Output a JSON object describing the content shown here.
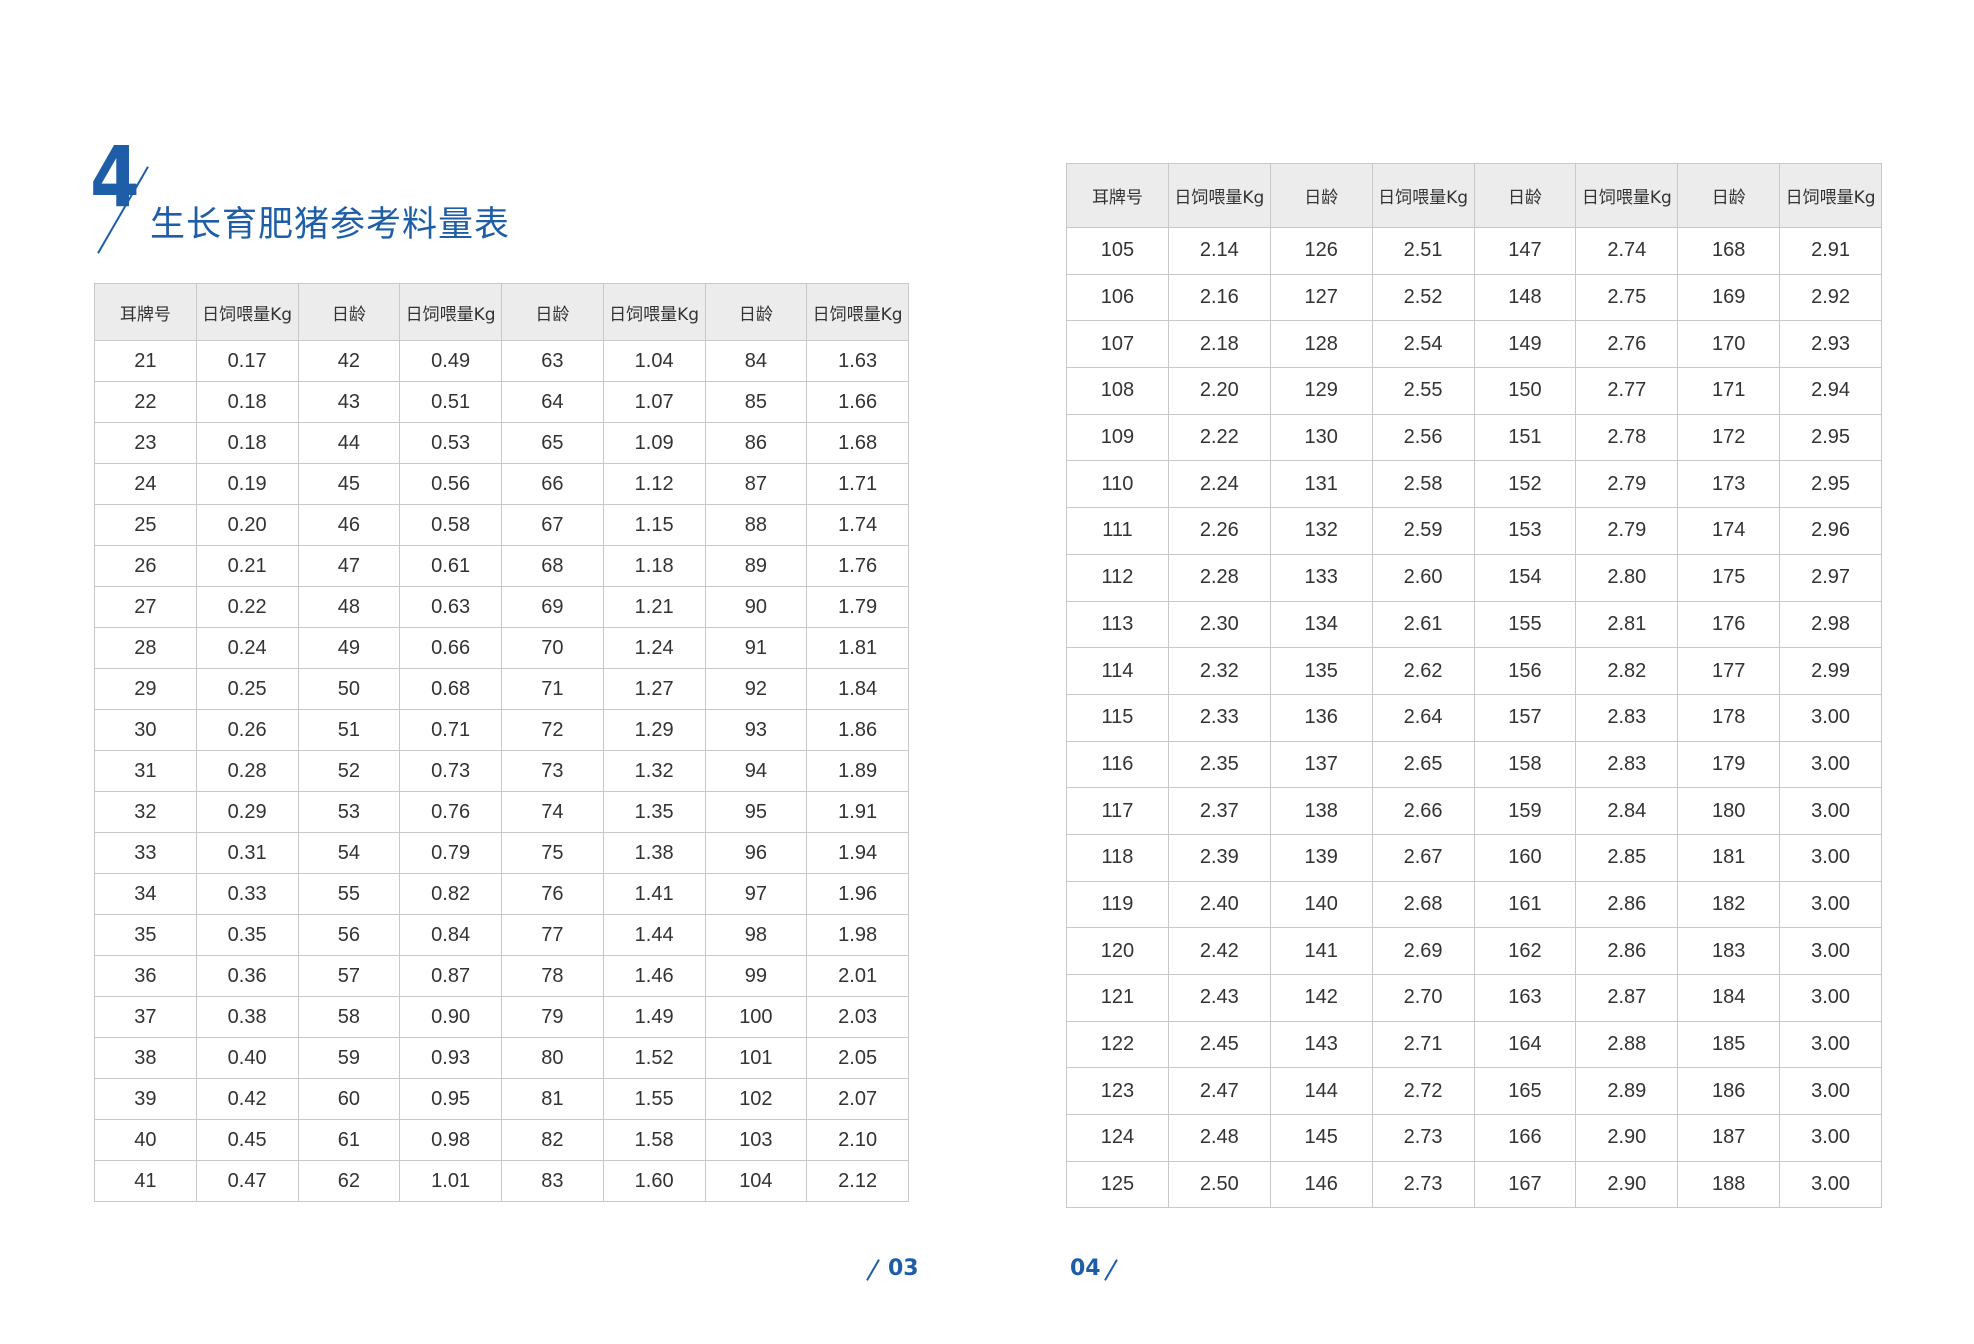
{
  "section": {
    "number": "4",
    "title": "生长育肥猪参考料量表"
  },
  "headers": [
    "耳牌号",
    "日饲喂量Kg",
    "日龄",
    "日饲喂量Kg",
    "日龄",
    "日饲喂量Kg",
    "日龄",
    "日饲喂量Kg"
  ],
  "left_rows": [
    [
      "21",
      "0.17",
      "42",
      "0.49",
      "63",
      "1.04",
      "84",
      "1.63"
    ],
    [
      "22",
      "0.18",
      "43",
      "0.51",
      "64",
      "1.07",
      "85",
      "1.66"
    ],
    [
      "23",
      "0.18",
      "44",
      "0.53",
      "65",
      "1.09",
      "86",
      "1.68"
    ],
    [
      "24",
      "0.19",
      "45",
      "0.56",
      "66",
      "1.12",
      "87",
      "1.71"
    ],
    [
      "25",
      "0.20",
      "46",
      "0.58",
      "67",
      "1.15",
      "88",
      "1.74"
    ],
    [
      "26",
      "0.21",
      "47",
      "0.61",
      "68",
      "1.18",
      "89",
      "1.76"
    ],
    [
      "27",
      "0.22",
      "48",
      "0.63",
      "69",
      "1.21",
      "90",
      "1.79"
    ],
    [
      "28",
      "0.24",
      "49",
      "0.66",
      "70",
      "1.24",
      "91",
      "1.81"
    ],
    [
      "29",
      "0.25",
      "50",
      "0.68",
      "71",
      "1.27",
      "92",
      "1.84"
    ],
    [
      "30",
      "0.26",
      "51",
      "0.71",
      "72",
      "1.29",
      "93",
      "1.86"
    ],
    [
      "31",
      "0.28",
      "52",
      "0.73",
      "73",
      "1.32",
      "94",
      "1.89"
    ],
    [
      "32",
      "0.29",
      "53",
      "0.76",
      "74",
      "1.35",
      "95",
      "1.91"
    ],
    [
      "33",
      "0.31",
      "54",
      "0.79",
      "75",
      "1.38",
      "96",
      "1.94"
    ],
    [
      "34",
      "0.33",
      "55",
      "0.82",
      "76",
      "1.41",
      "97",
      "1.96"
    ],
    [
      "35",
      "0.35",
      "56",
      "0.84",
      "77",
      "1.44",
      "98",
      "1.98"
    ],
    [
      "36",
      "0.36",
      "57",
      "0.87",
      "78",
      "1.46",
      "99",
      "2.01"
    ],
    [
      "37",
      "0.38",
      "58",
      "0.90",
      "79",
      "1.49",
      "100",
      "2.03"
    ],
    [
      "38",
      "0.40",
      "59",
      "0.93",
      "80",
      "1.52",
      "101",
      "2.05"
    ],
    [
      "39",
      "0.42",
      "60",
      "0.95",
      "81",
      "1.55",
      "102",
      "2.07"
    ],
    [
      "40",
      "0.45",
      "61",
      "0.98",
      "82",
      "1.58",
      "103",
      "2.10"
    ],
    [
      "41",
      "0.47",
      "62",
      "1.01",
      "83",
      "1.60",
      "104",
      "2.12"
    ]
  ],
  "right_rows": [
    [
      "105",
      "2.14",
      "126",
      "2.51",
      "147",
      "2.74",
      "168",
      "2.91"
    ],
    [
      "106",
      "2.16",
      "127",
      "2.52",
      "148",
      "2.75",
      "169",
      "2.92"
    ],
    [
      "107",
      "2.18",
      "128",
      "2.54",
      "149",
      "2.76",
      "170",
      "2.93"
    ],
    [
      "108",
      "2.20",
      "129",
      "2.55",
      "150",
      "2.77",
      "171",
      "2.94"
    ],
    [
      "109",
      "2.22",
      "130",
      "2.56",
      "151",
      "2.78",
      "172",
      "2.95"
    ],
    [
      "110",
      "2.24",
      "131",
      "2.58",
      "152",
      "2.79",
      "173",
      "2.95"
    ],
    [
      "111",
      "2.26",
      "132",
      "2.59",
      "153",
      "2.79",
      "174",
      "2.96"
    ],
    [
      "112",
      "2.28",
      "133",
      "2.60",
      "154",
      "2.80",
      "175",
      "2.97"
    ],
    [
      "113",
      "2.30",
      "134",
      "2.61",
      "155",
      "2.81",
      "176",
      "2.98"
    ],
    [
      "114",
      "2.32",
      "135",
      "2.62",
      "156",
      "2.82",
      "177",
      "2.99"
    ],
    [
      "115",
      "2.33",
      "136",
      "2.64",
      "157",
      "2.83",
      "178",
      "3.00"
    ],
    [
      "116",
      "2.35",
      "137",
      "2.65",
      "158",
      "2.83",
      "179",
      "3.00"
    ],
    [
      "117",
      "2.37",
      "138",
      "2.66",
      "159",
      "2.84",
      "180",
      "3.00"
    ],
    [
      "118",
      "2.39",
      "139",
      "2.67",
      "160",
      "2.85",
      "181",
      "3.00"
    ],
    [
      "119",
      "2.40",
      "140",
      "2.68",
      "161",
      "2.86",
      "182",
      "3.00"
    ],
    [
      "120",
      "2.42",
      "141",
      "2.69",
      "162",
      "2.86",
      "183",
      "3.00"
    ],
    [
      "121",
      "2.43",
      "142",
      "2.70",
      "163",
      "2.87",
      "184",
      "3.00"
    ],
    [
      "122",
      "2.45",
      "143",
      "2.71",
      "164",
      "2.88",
      "185",
      "3.00"
    ],
    [
      "123",
      "2.47",
      "144",
      "2.72",
      "165",
      "2.89",
      "186",
      "3.00"
    ],
    [
      "124",
      "2.48",
      "145",
      "2.73",
      "166",
      "2.90",
      "187",
      "3.00"
    ],
    [
      "125",
      "2.50",
      "146",
      "2.73",
      "167",
      "2.90",
      "188",
      "3.00"
    ]
  ],
  "pages": {
    "left": "03",
    "right": "04"
  },
  "colors": {
    "accent": "#1e5ea8",
    "header_bg": "#ececec",
    "grid": "#c8c8c8"
  }
}
